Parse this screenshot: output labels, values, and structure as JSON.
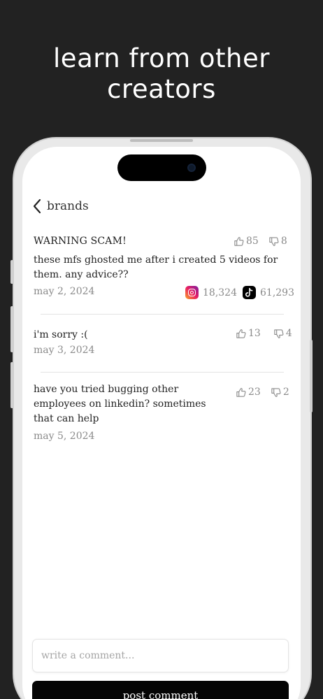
{
  "headline": {
    "line1": "learn from other",
    "line2": "creators"
  },
  "nav": {
    "back_label": "brands"
  },
  "post": {
    "title": "WARNING SCAM!",
    "body_line1": "these mfs ghosted me after i created 5 videos for",
    "body_line2": "them. any advice??",
    "date": "may 2, 2024",
    "likes": "85",
    "dislikes": "8",
    "instagram_count": "18,324",
    "tiktok_count": "61,293"
  },
  "comments": [
    {
      "body_line1": "i'm sorry :(",
      "date": "may 3, 2024",
      "likes": "13",
      "dislikes": "4"
    },
    {
      "body_line1": "have you tried bugging other",
      "body_line2": "employees on linkedin? sometimes",
      "body_line3": "that can help",
      "date": "may 5, 2024",
      "likes": "23",
      "dislikes": "2"
    }
  ],
  "composer": {
    "placeholder": "write a comment...",
    "post_label": "post comment"
  },
  "icons": {
    "back": "chevron-left-icon",
    "like": "thumbs-up-icon",
    "dislike": "thumbs-down-icon",
    "instagram": "instagram-icon",
    "tiktok": "tiktok-icon"
  },
  "colors": {
    "background": "#222222",
    "screen": "#ffffff",
    "button": "#050505",
    "muted_text": "#8a8a8a"
  }
}
